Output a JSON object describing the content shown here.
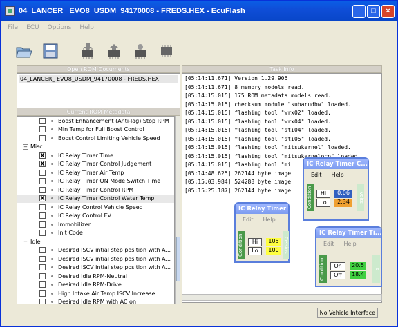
{
  "window": {
    "title": "04_LANCER_ EVO8_USDM_94170008 - FREDS.HEX - EcuFlash"
  },
  "menu": [
    "File",
    "ECU",
    "Options",
    "Help"
  ],
  "toolbar": {
    "icons": [
      "open-folder-icon",
      "save-disk-icon",
      "chip-read-icon",
      "chip-write-icon",
      "chip-test-icon",
      "chip-icon"
    ]
  },
  "rom_panel": {
    "header": "Open ROM Documents",
    "item": "04_LANCER_ EVO8_USDM_94170008 - FREDS.HEX"
  },
  "meta_panel": {
    "header": "Current ROM Metadata"
  },
  "meta_rows": [
    {
      "type": "item",
      "label": "Boost Enhancement (Anti-lag) Stop RPM",
      "checked": ""
    },
    {
      "type": "item",
      "label": "Min Temp for Full Boost Control",
      "checked": ""
    },
    {
      "type": "item",
      "label": "Boost Control Limiting Vehicle Speed",
      "checked": ""
    },
    {
      "type": "cat",
      "label": "Misc"
    },
    {
      "type": "item",
      "label": "IC Relay Timer Time",
      "checked": "X"
    },
    {
      "type": "item",
      "label": "IC Relay Timer Control Judgement",
      "checked": "X"
    },
    {
      "type": "item",
      "label": "IC Relay Timer Air Temp",
      "checked": ""
    },
    {
      "type": "item",
      "label": "IC Relay Timer ON Mode Switch Time",
      "checked": ""
    },
    {
      "type": "item",
      "label": "IC Relay Timer Control RPM",
      "checked": ""
    },
    {
      "type": "item",
      "label": "IC Relay Timer Control Water Temp",
      "checked": "X",
      "sel": true
    },
    {
      "type": "item",
      "label": "IC Relay Control Vehicle Speed",
      "checked": ""
    },
    {
      "type": "item",
      "label": "IC Relay Control EV",
      "checked": ""
    },
    {
      "type": "item",
      "label": "Immobilizer",
      "checked": ""
    },
    {
      "type": "item",
      "label": "Init Code",
      "checked": ""
    },
    {
      "type": "cat",
      "label": "Idle"
    },
    {
      "type": "item",
      "label": "Desired ISCV intial step position with A...",
      "checked": ""
    },
    {
      "type": "item",
      "label": "Desired ISCV intial step position with A...",
      "checked": ""
    },
    {
      "type": "item",
      "label": "Desired ISCV intial step position with A...",
      "checked": ""
    },
    {
      "type": "item",
      "label": "Desired Idle RPM-Neutral",
      "checked": ""
    },
    {
      "type": "item",
      "label": "Desired Idle RPM-Drive",
      "checked": ""
    },
    {
      "type": "item",
      "label": "High Intake Air Temp ISCV Increase",
      "checked": ""
    },
    {
      "type": "item",
      "label": "Desired Idle RPM with AC on",
      "checked": ""
    }
  ],
  "task_panel": {
    "header": "Task Info"
  },
  "log": [
    "[05:14:11.671] Version 1.29.906",
    "[05:14:11.671] 8 memory models read.",
    "[05:14:15.015] 175 ROM metadata models read.",
    "[05:14:15.015] checksum module \"subarudbw\" loaded.",
    "[05:14:15.015] flashing tool \"wrx02\" loaded.",
    "[05:14:15.015] flashing tool \"wrx04\" loaded.",
    "[05:14:15.015] flashing tool \"sti04\" loaded.",
    "[05:14:15.015] flashing tool \"sti05\" loaded.",
    "[05:14:15.015] flashing tool \"mitsukernel\" loaded.",
    "[05:14:15.015] flashing tool \"mitsukernelocp\" loaded.",
    "[05:14:15.015] flashing tool \"mi",
    "[05:14:48.625] 262144 byte image",
    "[05:15:03.984] 524288 byte image",
    "[05:15:25.187] 262144 byte image"
  ],
  "status": {
    "text": "No Vehicle Interface"
  },
  "popup1": {
    "title": "IC Relay Timer C...",
    "menu_edit": "Edit",
    "menu_help": "Help",
    "axis_label": "Condition",
    "btn1": "Hi",
    "btn2": "Lo",
    "val1": "0.06",
    "val2": "2.34",
    "unit": "Volts",
    "val1_color": "#3060c0",
    "val2_color": "#f0a030"
  },
  "popup2": {
    "title": "IC Relay Timer ...",
    "menu_edit": "Edit",
    "menu_help": "Help",
    "axis_label": "Condition",
    "btn1": "Hi",
    "btn2": "Lo",
    "val1": "105",
    "val2": "100",
    "unit": "Celsius",
    "val_color": "#ffff40"
  },
  "popup3": {
    "title": "IC Relay Timer Ti...",
    "menu_edit": "Edit",
    "menu_help": "Help",
    "axis_label": "Condition",
    "btn1": "On",
    "btn2": "Off",
    "val1": "20.5",
    "val2": "18.4",
    "unit": "s",
    "val_color": "#40d040"
  }
}
